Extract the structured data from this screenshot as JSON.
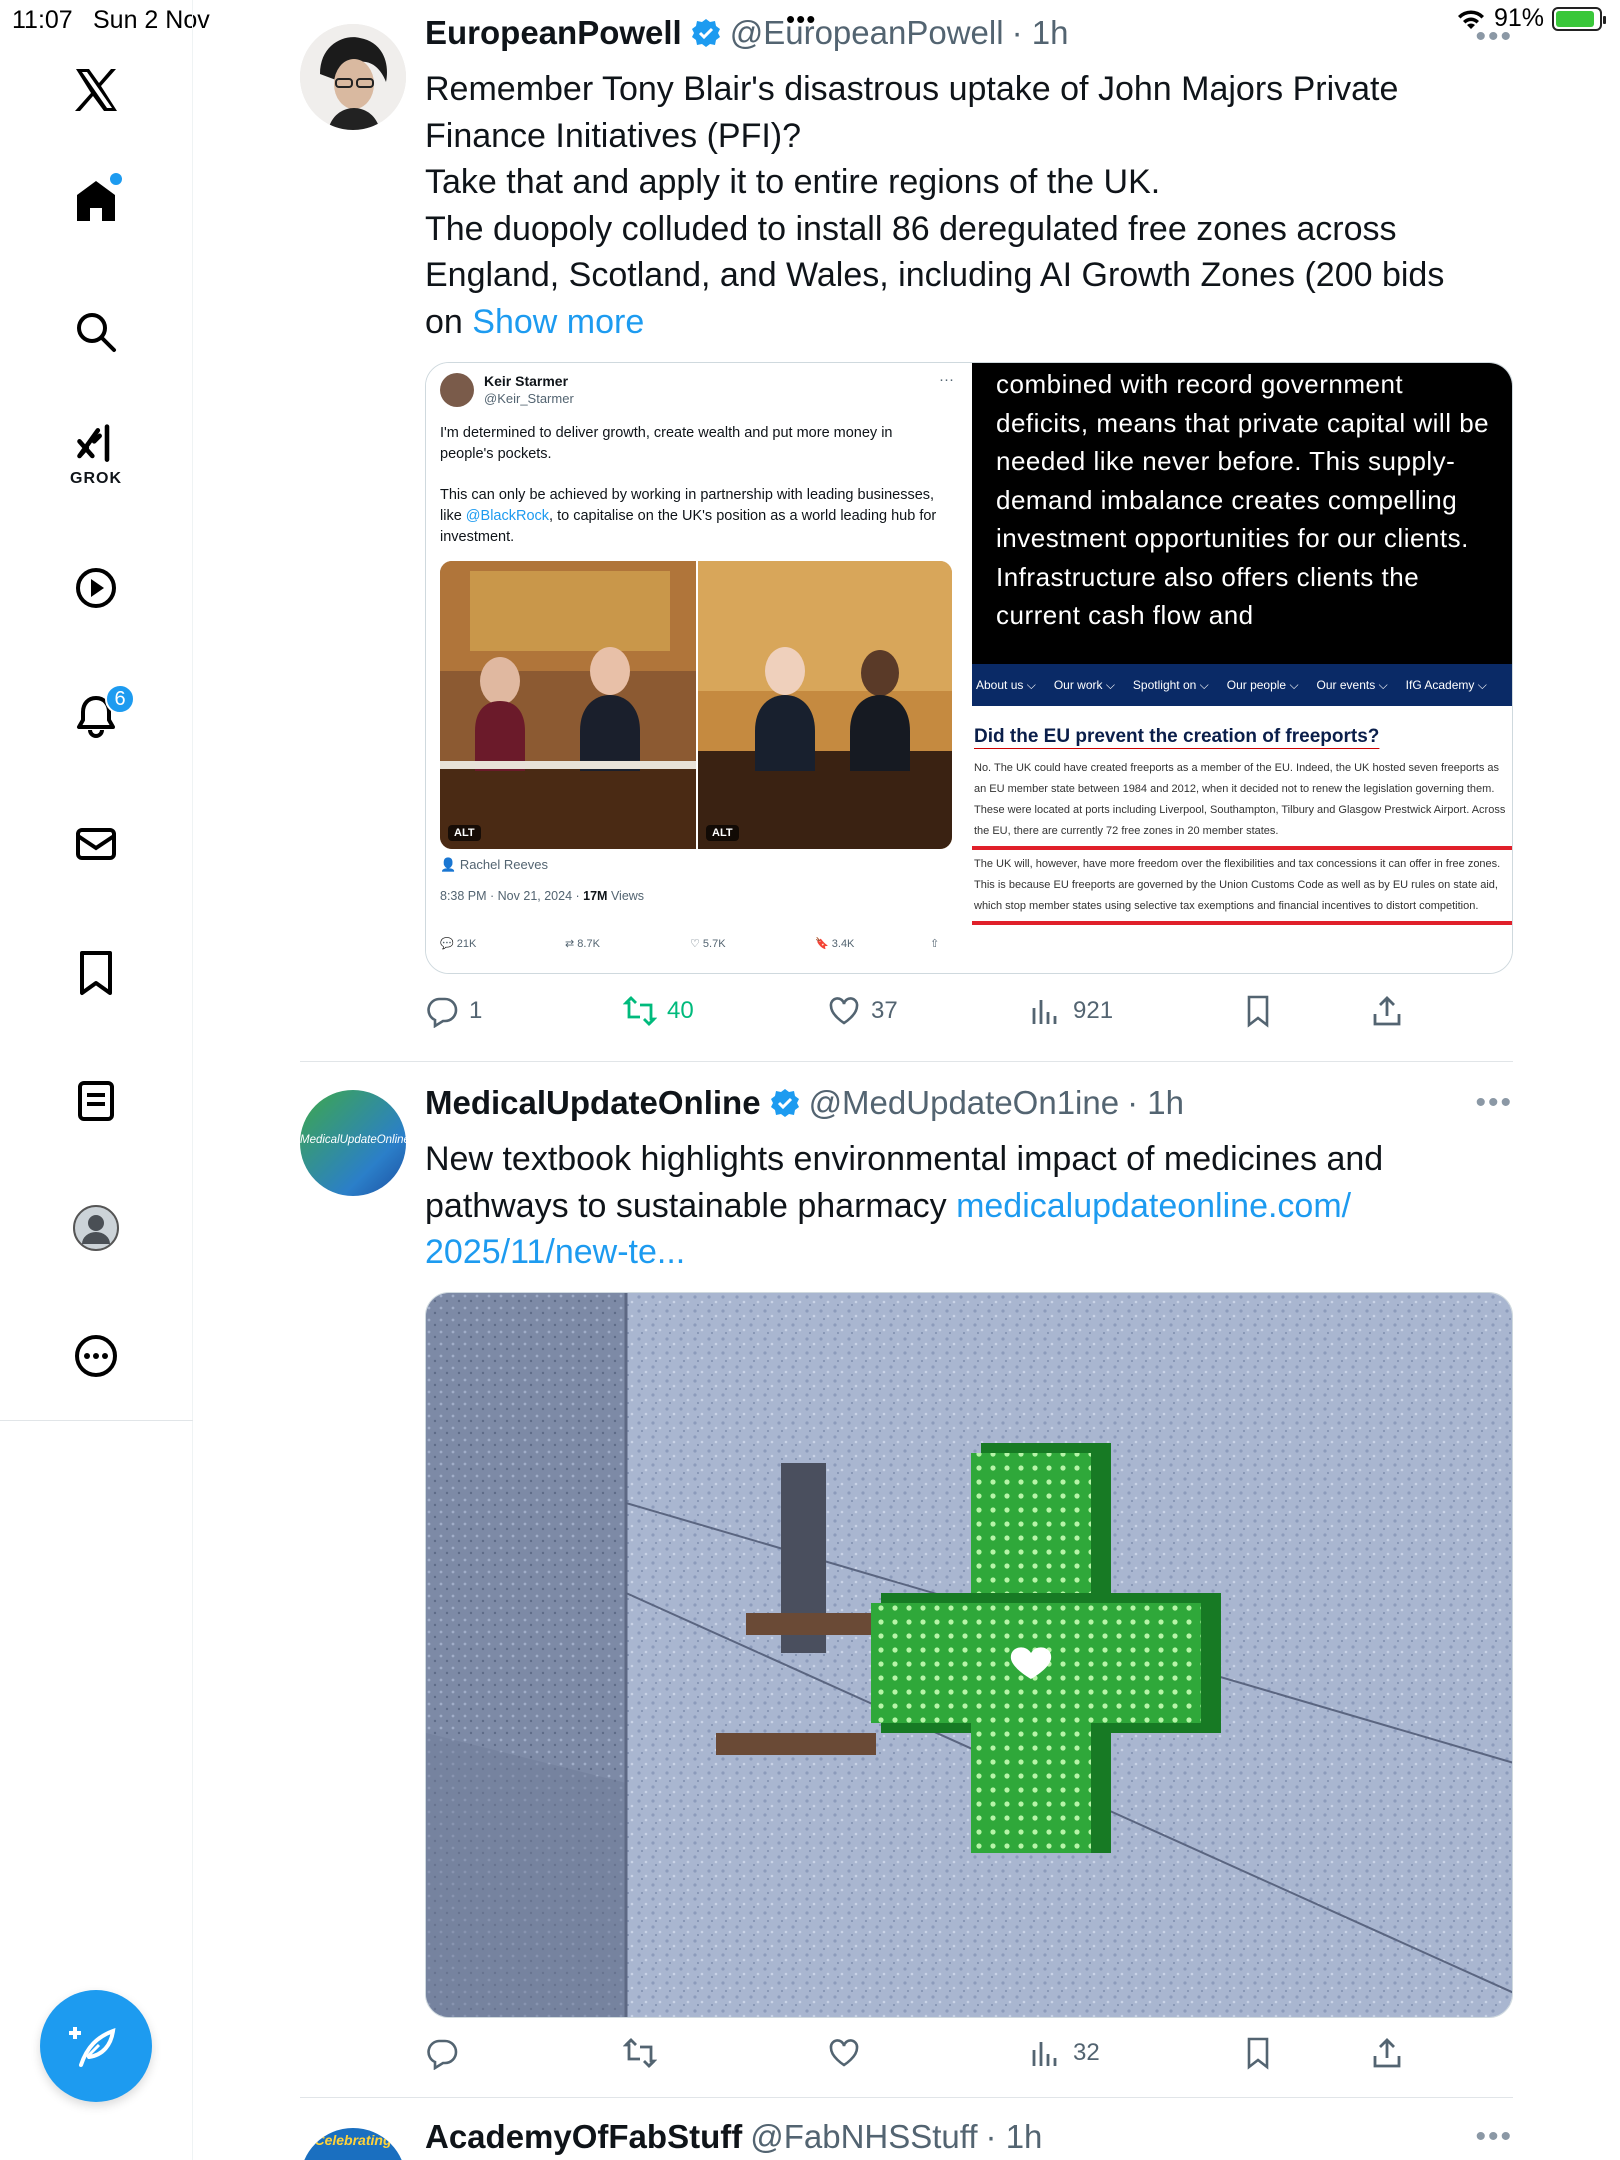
{
  "status_bar": {
    "time": "11:07",
    "date": "Sun 2 Nov",
    "battery": "91%",
    "battery_level": 0.91
  },
  "sidebar": {
    "grok_label": "GROK",
    "notifications_badge": "6"
  },
  "colors": {
    "accent": "#1d9bf0",
    "retweet_active": "#00ba7c",
    "text_secondary": "#536471"
  },
  "tweets": [
    {
      "name": "EuropeanPowell",
      "handle": "@EuropeanPowell",
      "time": "· 1h",
      "text_lines": [
        "Remember Tony Blair's disastrous uptake of John Majors Private",
        "Finance Initiatives (PFI)?",
        "Take that and apply it to entire regions of the UK.",
        "The duopoly colluded to install 86 deregulated free zones across",
        "England, Scotland, and Wales, including AI Growth Zones (200 bids",
        "on"
      ],
      "show_more": "Show more",
      "embedded_tweet": {
        "name": "Keir Starmer",
        "handle": "@Keir_Starmer",
        "para1": "I'm determined to deliver growth, create wealth and put more money in people's pockets.",
        "para2_prefix": "This can only be achieved by working in partnership with leading businesses, like ",
        "para2_link": "@BlackRock",
        "para2_suffix": ", to capitalise on the UK's position as a world leading hub for investment.",
        "alt1": "ALT",
        "alt2": "ALT",
        "tagged": "Rachel Reeves",
        "timestamp": "8:38 PM · Nov 21, 2024 · ",
        "views_count": "17M",
        "views_label": " Views",
        "replies": "21K",
        "reposts": "8.7K",
        "likes": "5.7K",
        "bookmarks": "3.4K"
      },
      "black_text": "combined with record government deficits, means that private capital will be needed like never before. This supply-demand imbalance creates compelling investment opportunities for our clients. Infrastructure also offers clients the current cash flow and",
      "ifg": {
        "nav": [
          "About us ⌵",
          "Our work ⌵",
          "Spotlight on ⌵",
          "Our people ⌵",
          "Our events ⌵",
          "IfG Academy ⌵"
        ],
        "heading": "Did the EU prevent the creation of freeports?",
        "p1": "No. The UK could have created freeports as a member of the EU. Indeed, the UK hosted seven freeports as an EU member state between 1984 and 2012, when it decided not to renew the legislation governing them. These were located at ports including Liverpool, Southampton, Tilbury and Glasgow Prestwick Airport. Across the EU, there are currently 72 free zones in 20 member states.",
        "p2": "The UK will, however, have more freedom over the flexibilities and tax concessions it can offer in free zones. This is because EU freeports are governed by the Union Customs Code as well as by EU rules on state aid, which stop member states using selective tax exemptions and financial incentives to distort competition."
      },
      "stats": {
        "replies": "1",
        "reposts": "40",
        "likes": "37",
        "views": "921"
      }
    },
    {
      "name": "MedicalUpdateOnline",
      "handle": "@MedUpdateOn1ine",
      "time": "· 1h",
      "avatar_text": "MedicalUpdateOnline",
      "text_lines": [
        "New textbook highlights environmental impact of medicines and",
        "pathways to sustainable pharmacy "
      ],
      "link_1": "medicalupdateonline.com/",
      "link_2": "2025/11/new-te...",
      "stats": {
        "views": "32"
      }
    },
    {
      "name": "AcademyOfFabStuff",
      "handle": "@FabNHSStuff",
      "time": "· 1h",
      "avatar_text": "Celebrating"
    }
  ]
}
